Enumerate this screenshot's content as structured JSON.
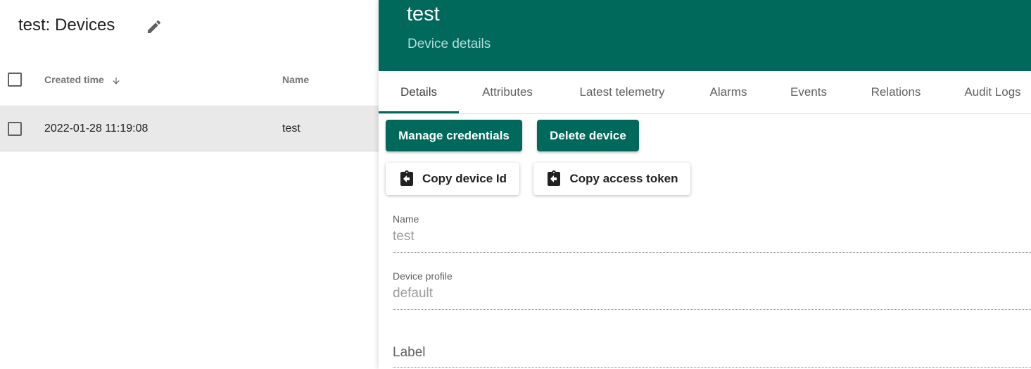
{
  "list": {
    "title": "test: Devices",
    "columns": {
      "created_time": "Created time",
      "name": "Name"
    },
    "rows": [
      {
        "created_time": "2022-01-28 11:19:08",
        "name": "test"
      }
    ]
  },
  "drawer": {
    "entity_name": "test",
    "subtitle": "Device details",
    "tabs": [
      "Details",
      "Attributes",
      "Latest telemetry",
      "Alarms",
      "Events",
      "Relations",
      "Audit Logs"
    ],
    "active_tab": "Details",
    "buttons": {
      "manage_credentials": "Manage credentials",
      "delete_device": "Delete device",
      "copy_device_id": "Copy device Id",
      "copy_access_token": "Copy access token"
    },
    "fields": {
      "name": {
        "label": "Name",
        "value": "test"
      },
      "device_profile": {
        "label": "Device profile",
        "value": "default"
      },
      "label": {
        "label": "Label",
        "value": ""
      }
    }
  },
  "colors": {
    "primary": "#00695c",
    "header_subtitle": "#b2dfdb",
    "selected_row": "#e9e9e9"
  },
  "icons": {
    "edit": "pencil-icon",
    "sort": "arrow-down-icon",
    "copy": "clipboard-left-icon"
  }
}
